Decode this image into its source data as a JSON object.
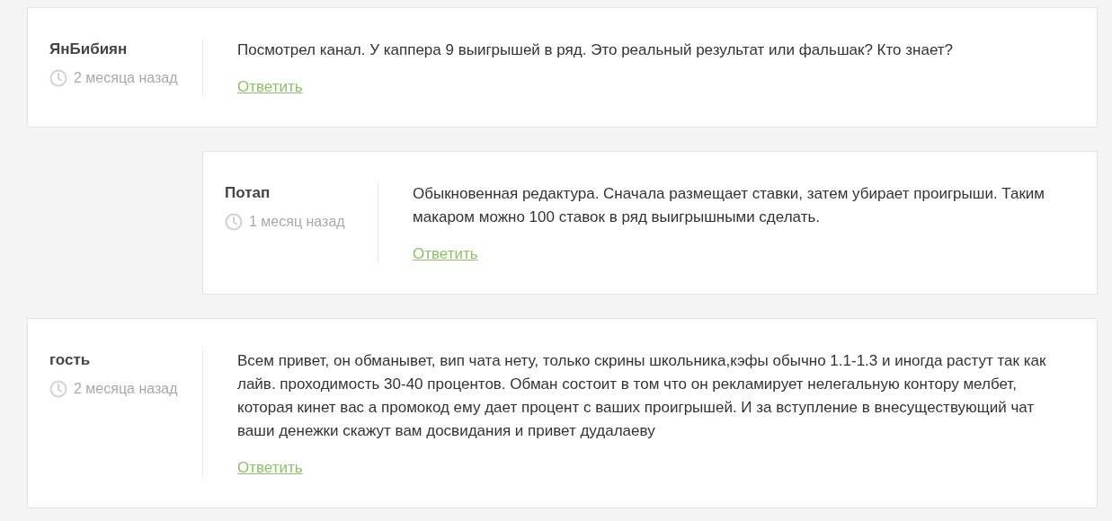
{
  "comments": [
    {
      "author": "ЯнБибиян",
      "time": "2 месяца назад",
      "text": "Посмотрел канал. У каппера 9 выигрышей в ряд. Это реальный результат или фальшак? Кто знает?",
      "reply_link": "Ответить",
      "children": [
        {
          "author": "Потап",
          "time": "1 месяц назад",
          "text": "Обыкновенная редактура. Сначала размещает ставки, затем убирает проигрыши. Таким макаром можно 100 ставок в ряд выигрышными сделать.",
          "reply_link": "Ответить"
        }
      ]
    },
    {
      "author": "гость",
      "time": "2 месяца назад",
      "text": "Всем привет, он обманывет, вип чата нету, только скрины школьника,кэфы обычно 1.1-1.3 и иногда растут так как лайв. проходимость 30-40 процентов. Обман состоит в том что он рекламирует нелегальную контору мелбет, которая кинет вас а промокод ему дает процент с ваших проигрышей. И за вступление в внесуществующий чат ваши денежки скажут вам досвидания и привет дудалаеву",
      "reply_link": "Ответить"
    }
  ]
}
